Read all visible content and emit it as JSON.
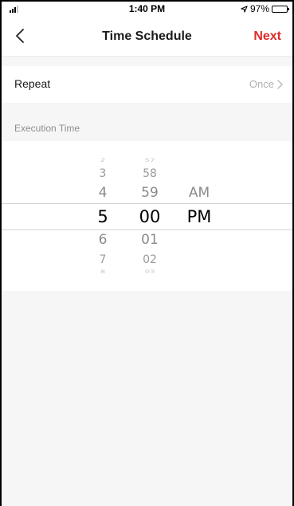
{
  "status_bar": {
    "time": "1:40 PM",
    "battery": "97%",
    "icons": [
      "signal-icon",
      "location-arrow-icon",
      "battery-icon"
    ]
  },
  "nav": {
    "back_icon": "chevron-left-icon",
    "title": "Time Schedule",
    "next_label": "Next",
    "next_color": "#e02b2b"
  },
  "repeat": {
    "label": "Repeat",
    "value": "Once",
    "chevron_icon": "chevron-right-icon"
  },
  "execution": {
    "header": "Execution Time",
    "picker": {
      "hours": [
        "2",
        "3",
        "4",
        "5",
        "6",
        "7",
        "8"
      ],
      "minutes": [
        "57",
        "58",
        "59",
        "00",
        "01",
        "02",
        "03"
      ],
      "periods": [
        "AM",
        "PM"
      ],
      "selected": {
        "hour": "5",
        "minute": "00",
        "period": "PM"
      }
    }
  }
}
